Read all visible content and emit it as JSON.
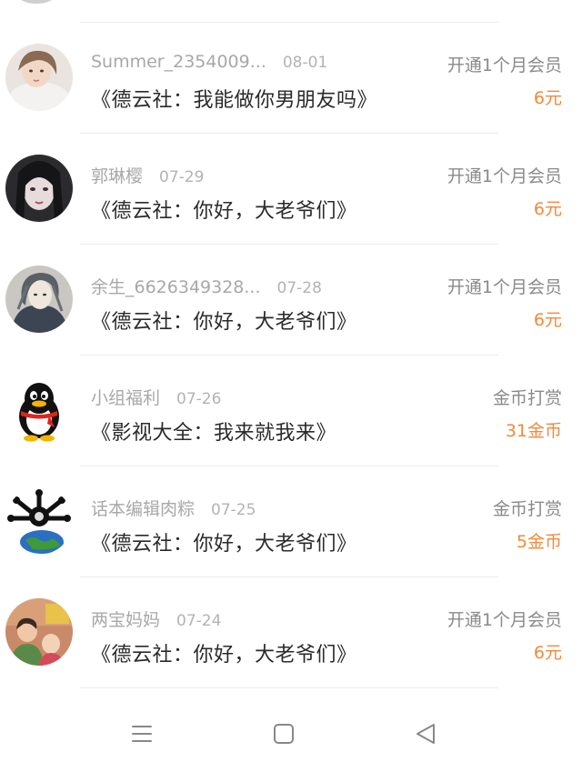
{
  "rows": [
    {
      "name": "Summer_2354009...",
      "date": "08-01",
      "title": "《德云社：我能做你男朋友吗》",
      "type": "开通1个月会员",
      "amount": "6元",
      "avatar_icon": "girl-avatar-icon"
    },
    {
      "name": "郭琳樱",
      "date": "07-29",
      "title": "《德云社：你好，大老爷们》",
      "type": "开通1个月会员",
      "amount": "6元",
      "avatar_icon": "dark-hair-girl-avatar-icon"
    },
    {
      "name": "余生_6626349328...",
      "date": "07-28",
      "title": "《德云社：你好，大老爷们》",
      "type": "开通1个月会员",
      "amount": "6元",
      "avatar_icon": "anime-boy-avatar-icon"
    },
    {
      "name": "小组福利",
      "date": "07-26",
      "title": "《影视大全：我来就我来》",
      "type": "金币打赏",
      "amount": "31金币",
      "avatar_icon": "qq-penguin-avatar-icon"
    },
    {
      "name": "话本编辑肉粽",
      "date": "07-25",
      "title": "《德云社：你好，大老爷们》",
      "type": "金币打赏",
      "amount": "5金币",
      "avatar_icon": "globe-avatar-icon"
    },
    {
      "name": "两宝妈妈",
      "date": "07-24",
      "title": "《德云社：你好，大老爷们》",
      "type": "开通1个月会员",
      "amount": "6元",
      "avatar_icon": "kids-photo-avatar-icon"
    }
  ],
  "navbar": {
    "menu_icon": "menu-icon",
    "home_icon": "home-square-icon",
    "back_icon": "back-triangle-icon"
  },
  "colors": {
    "amount": "#f08a3c",
    "name": "#a8a8a8",
    "title": "#2a2a2a",
    "type": "#8a8a8a"
  }
}
